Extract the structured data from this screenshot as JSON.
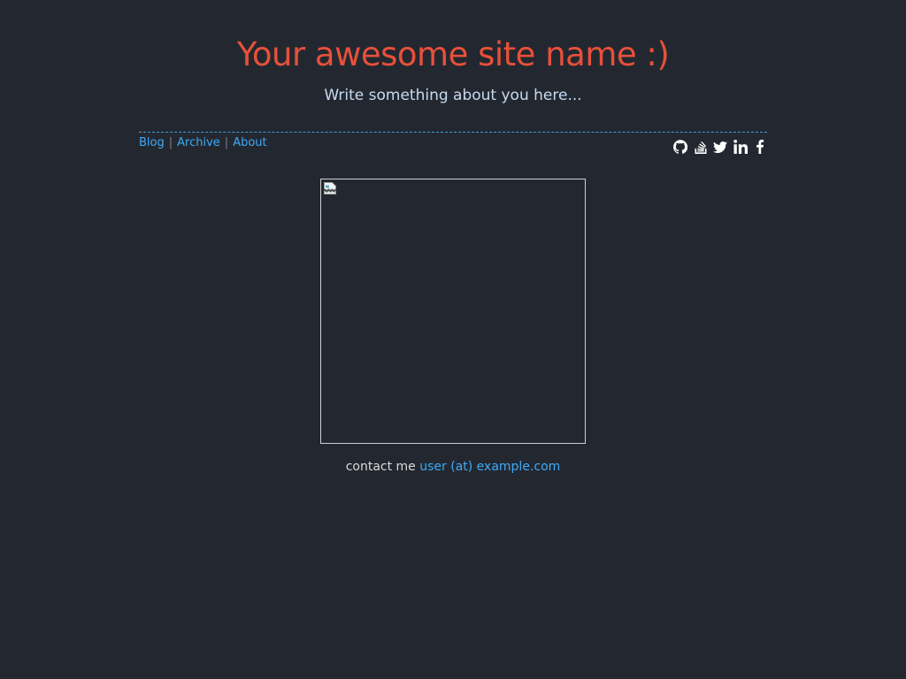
{
  "colors": {
    "background": "#232830",
    "title": "#e8503a",
    "tagline": "#c8daf0",
    "link": "#3fa9f5",
    "separator": "#7a8290",
    "divider": "#3fa0d9",
    "icon": "#ffffff",
    "text": "#d9d9d9",
    "image_border": "#cfcfcf"
  },
  "header": {
    "site_name": "Your awesome site name :)",
    "tagline": "Write something about you here..."
  },
  "nav": {
    "items": [
      {
        "label": "Blog"
      },
      {
        "label": "Archive"
      },
      {
        "label": "About"
      }
    ],
    "separator": "|"
  },
  "social": [
    {
      "icon": "github-icon"
    },
    {
      "icon": "stackoverflow-icon"
    },
    {
      "icon": "twitter-icon"
    },
    {
      "icon": "linkedin-icon"
    },
    {
      "icon": "facebook-icon"
    }
  ],
  "main": {
    "image_state": "broken-image"
  },
  "contact": {
    "label": "contact me",
    "email_text": "user (at) example.com"
  }
}
